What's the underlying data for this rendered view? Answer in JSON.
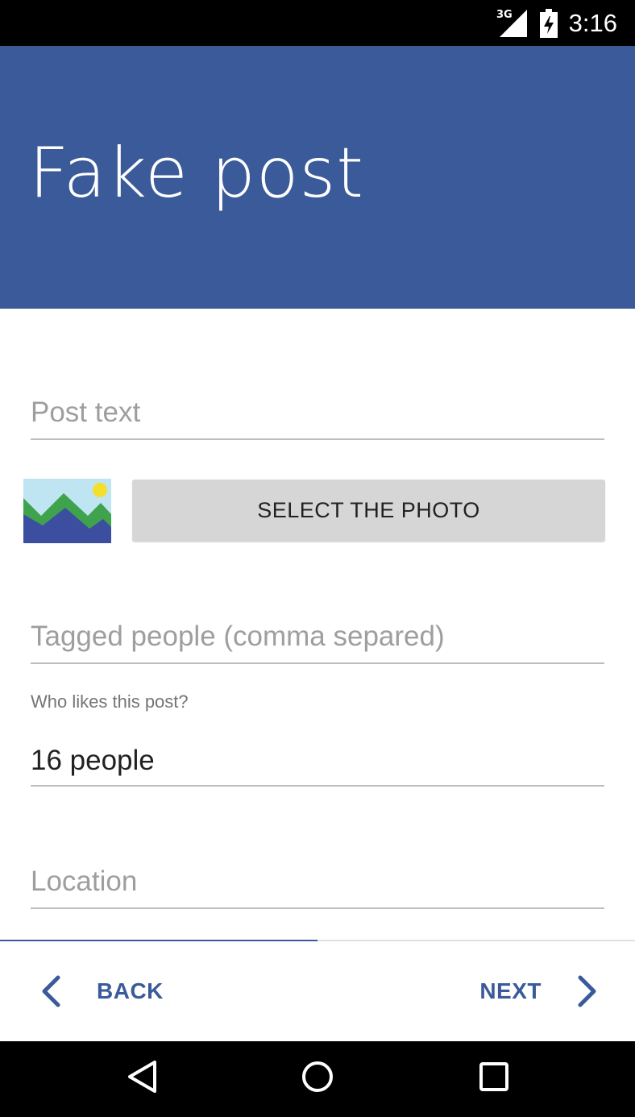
{
  "status_bar": {
    "network": "3G",
    "time": "3:16",
    "icons": [
      "signal-icon",
      "battery-icon"
    ]
  },
  "header": {
    "title": "Fake post",
    "color": "#3a5a99"
  },
  "form": {
    "post_text": {
      "placeholder": "Post text"
    },
    "photo": {
      "icon": "image-icon",
      "button_label": "SELECT THE PHOTO"
    },
    "tagged_people": {
      "placeholder": "Tagged people (comma separed)"
    },
    "likes": {
      "label": "Who likes this post?",
      "value": "16 people"
    },
    "location": {
      "placeholder": "Location"
    }
  },
  "progress": {
    "fraction": 0.5
  },
  "navigation": {
    "back_label": "BACK",
    "next_label": "NEXT",
    "back_icon": "chevron-left-icon",
    "next_icon": "chevron-right-icon"
  },
  "system_nav": {
    "icons": [
      "back-triangle-icon",
      "home-circle-icon",
      "recents-square-icon"
    ]
  }
}
